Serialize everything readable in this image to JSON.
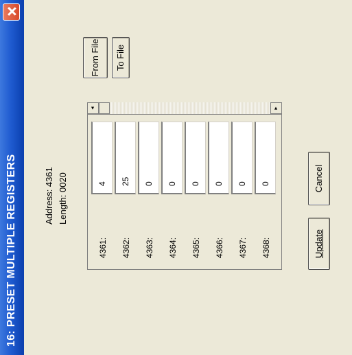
{
  "window": {
    "title": "16: PRESET MULTIPLE REGISTERS",
    "close_icon": "close-icon"
  },
  "info": {
    "address": "Address: 4361",
    "length": "Length: 0020"
  },
  "registers": [
    {
      "label": "4361:",
      "value": "4"
    },
    {
      "label": "4362:",
      "value": "25"
    },
    {
      "label": "4363:",
      "value": "0"
    },
    {
      "label": "4364:",
      "value": "0"
    },
    {
      "label": "4365:",
      "value": "0"
    },
    {
      "label": "4366:",
      "value": "0"
    },
    {
      "label": "4367:",
      "value": "0"
    },
    {
      "label": "4368:",
      "value": "0"
    }
  ],
  "buttons": {
    "from_file": "From File",
    "to_file": "To File",
    "update": "Update",
    "cancel": "Cancel"
  },
  "scrollbar": {
    "left_arrow": "◄",
    "right_arrow": "►"
  }
}
